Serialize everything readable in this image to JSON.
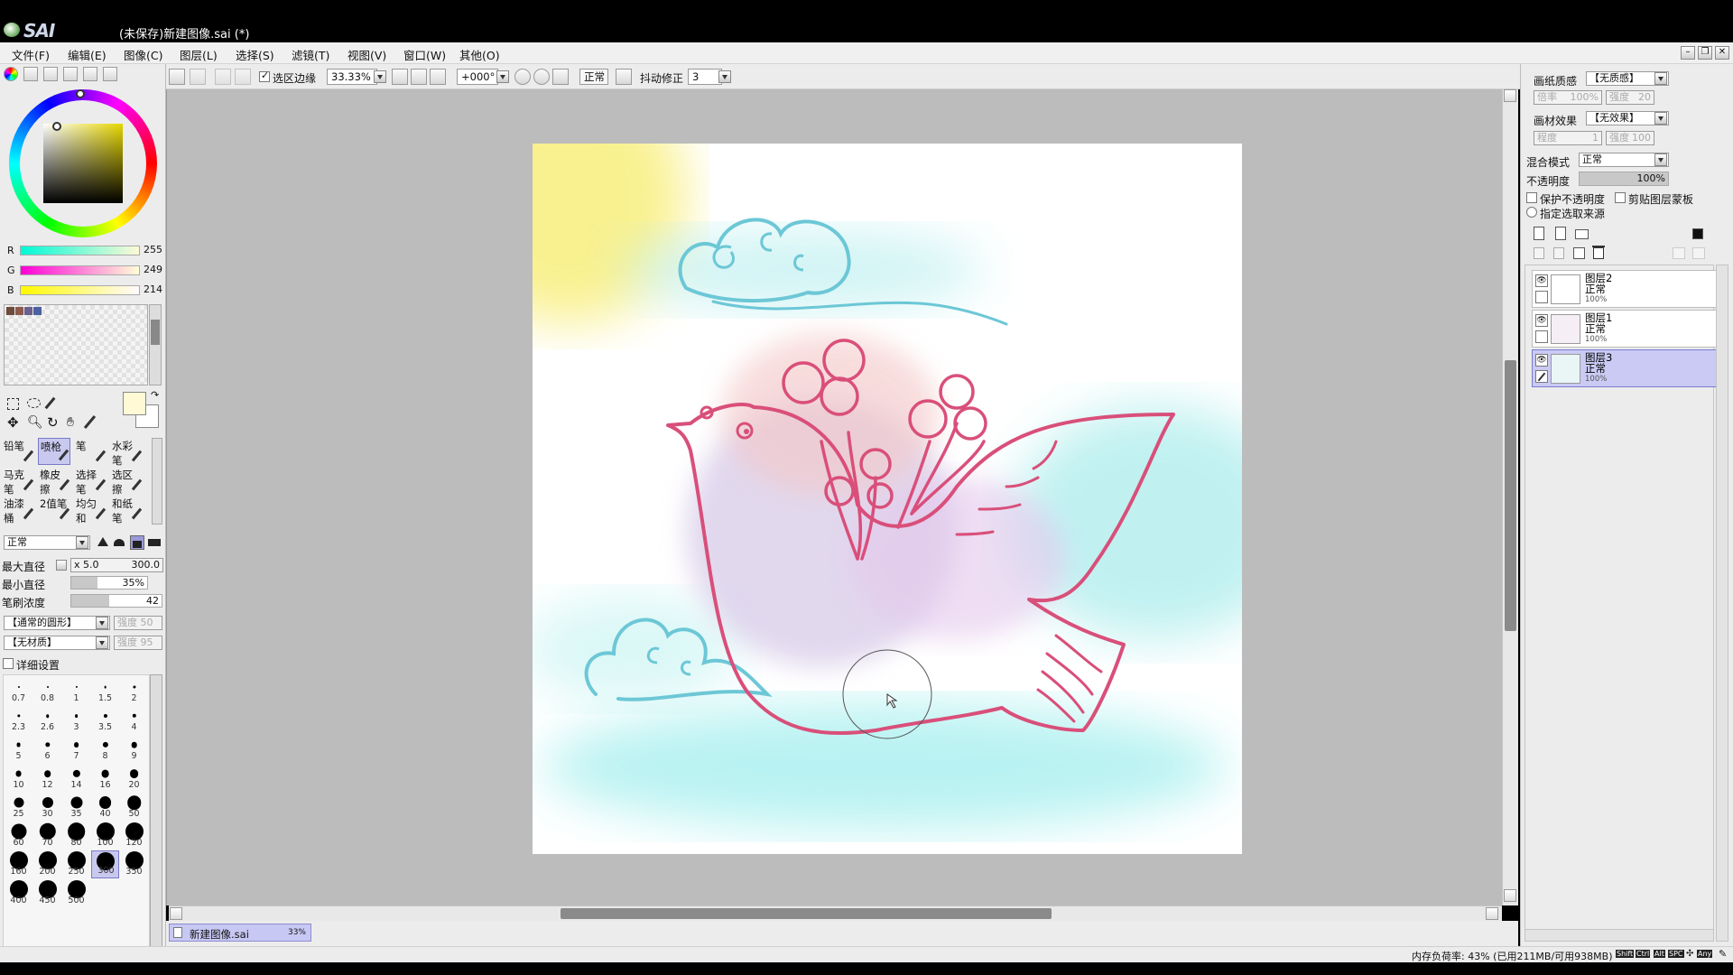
{
  "window": {
    "app_name": "SAI",
    "title": "(未保存)新建图像.sai (*)"
  },
  "menu": [
    "文件(F)",
    "编辑(E)",
    "图像(C)",
    "图层(L)",
    "选择(S)",
    "滤镜(T)",
    "视图(V)",
    "窗口(W)",
    "其他(O)"
  ],
  "toolbar": {
    "selection_edge_label": "选区边缘",
    "selection_edge_checked": true,
    "zoom": "33.33%",
    "rotation": "+000°",
    "blend_mode": "正常",
    "stabilizer_label": "抖动修正",
    "stabilizer_value": "3"
  },
  "color": {
    "r_label": "R",
    "r_value": "255",
    "g_label": "G",
    "g_value": "249",
    "b_label": "B",
    "b_value": "214",
    "swatches": [
      "#6e4b3a",
      "#8c5a4c",
      "#6a5f8e",
      "#4c5fa0"
    ],
    "foreground": "#fff9d6"
  },
  "tools": [
    {
      "label": "铅笔",
      "selected": false
    },
    {
      "label": "喷枪",
      "selected": true
    },
    {
      "label": "笔",
      "selected": false
    },
    {
      "label": "水彩笔",
      "selected": false
    },
    {
      "label": "马克笔",
      "selected": false
    },
    {
      "label": "橡皮擦",
      "selected": false
    },
    {
      "label": "选择笔",
      "selected": false
    },
    {
      "label": "选区擦",
      "selected": false
    },
    {
      "label": "油漆桶",
      "selected": false
    },
    {
      "label": "2值笔",
      "selected": false
    },
    {
      "label": "均匀和",
      "selected": false
    },
    {
      "label": "和纸笔",
      "selected": false
    }
  ],
  "brush": {
    "mode": "正常",
    "max_size_label": "最大直径",
    "max_size_multiplier": "x 5.0",
    "max_size_value": "300.0",
    "min_size_label": "最小直径",
    "min_size_value": "35%",
    "min_size_percent": 35,
    "density_label": "笔刷浓度",
    "density_value": "42",
    "density_percent": 42,
    "shape": "【通常的圆形】",
    "shape_strength": "强度 50",
    "texture": "【无材质】",
    "texture_strength": "强度 95",
    "detail_label": "详细设置"
  },
  "brush_sizes": [
    "0.7",
    "0.8",
    "1",
    "1.5",
    "2",
    "2.3",
    "2.6",
    "3",
    "3.5",
    "4",
    "5",
    "6",
    "7",
    "8",
    "9",
    "10",
    "12",
    "14",
    "16",
    "20",
    "25",
    "30",
    "35",
    "40",
    "50",
    "60",
    "70",
    "80",
    "100",
    "120",
    "160",
    "200",
    "250",
    "300",
    "350",
    "400",
    "450",
    "500"
  ],
  "brush_size_selected": "300",
  "doc_tab": {
    "name": "新建图像.sai",
    "zoom": "33%"
  },
  "layer_panel": {
    "paper_texture_label": "画纸质感",
    "paper_texture_value": "【无质感】",
    "paper_scale_label": "倍率",
    "paper_scale_value": "100%",
    "paper_strength_label": "强度",
    "paper_strength_value": "20",
    "paper_effect_label": "画材效果",
    "paper_effect_value": "【无效果】",
    "effect_degree_label": "程度",
    "effect_degree_value": "1",
    "effect_strength_label": "强度",
    "effect_strength_value": "100",
    "blend_label": "混合模式",
    "blend_value": "正常",
    "opacity_label": "不透明度",
    "opacity_value": "100%",
    "protect_opacity_label": "保护不透明度",
    "clip_label": "剪贴图层蒙板",
    "select_source_label": "指定选取来源",
    "layers": [
      {
        "name": "图层2",
        "mode": "正常",
        "opacity": "100%",
        "selected": false
      },
      {
        "name": "图层1",
        "mode": "正常",
        "opacity": "100%",
        "selected": false
      },
      {
        "name": "图层3",
        "mode": "正常",
        "opacity": "100%",
        "selected": true
      }
    ]
  },
  "status": {
    "memory": "内存负荷率: 43% (已用211MB/可用938MB)",
    "keys": [
      "Shift",
      "Ctrl",
      "Alt",
      "SPC",
      "Any"
    ]
  }
}
